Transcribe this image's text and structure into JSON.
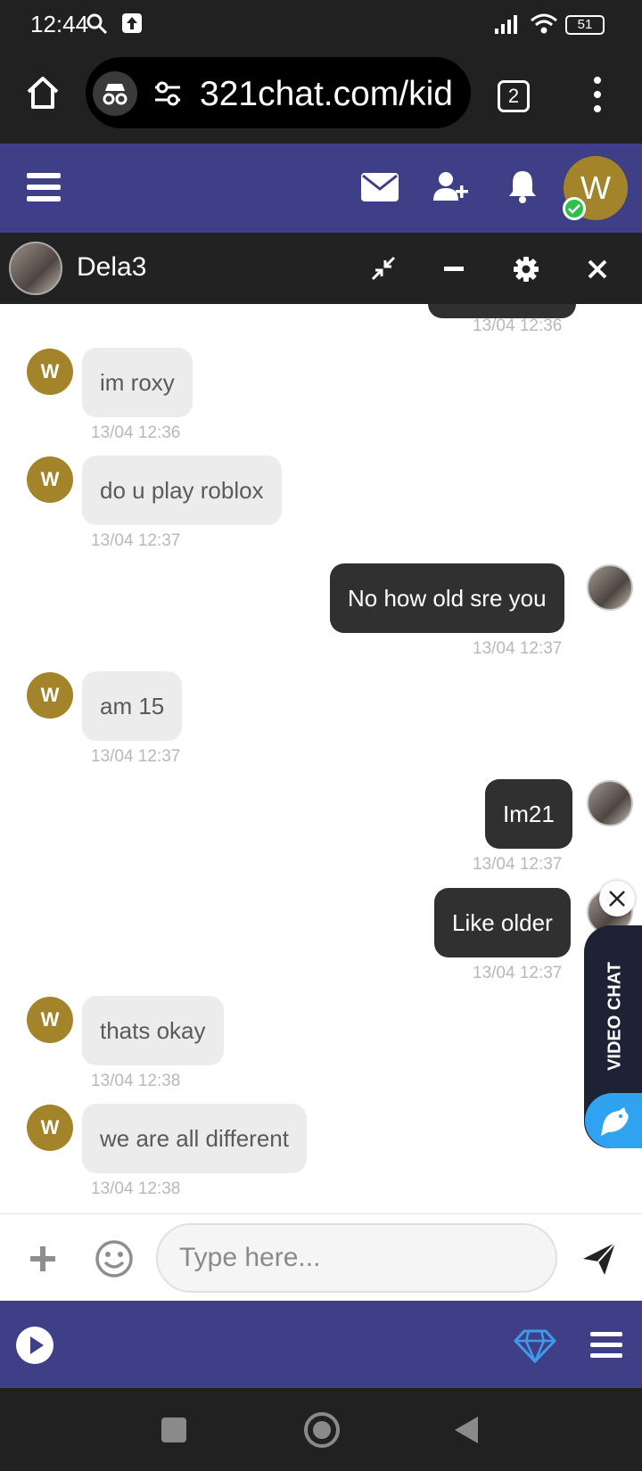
{
  "status_bar": {
    "time": "12:44",
    "battery": "51"
  },
  "browser": {
    "url": "321chat.com/kid",
    "tab_count": "2"
  },
  "chat": {
    "contact_name": "Dela3"
  },
  "avatars": {
    "main_initial": "W",
    "contact_initial": "W"
  },
  "messages": [
    {
      "direction": "in",
      "text": "im roxy",
      "time": "13/04 12:36"
    },
    {
      "direction": "in",
      "text": "do u play roblox",
      "time": "13/04 12:37"
    },
    {
      "direction": "out",
      "text": "No how old sre you",
      "time": "13/04 12:37"
    },
    {
      "direction": "in",
      "text": "am 15",
      "time": "13/04 12:37"
    },
    {
      "direction": "out",
      "text": "Im21",
      "time": "13/04 12:37"
    },
    {
      "direction": "out",
      "text": "Like older",
      "time": "13/04 12:37"
    },
    {
      "direction": "in",
      "text": "thats okay",
      "time": "13/04 12:38"
    },
    {
      "direction": "in",
      "text": "we are all different",
      "time": "13/04 12:38"
    }
  ],
  "top_partial_timestamp": "13/04 12:36",
  "video_widget": {
    "label": "VIDEO CHAT"
  },
  "input": {
    "placeholder": "Type here..."
  },
  "colors": {
    "header_bg": "#3e3f86",
    "avatar_bg": "#a3842a",
    "online": "#2ec04a",
    "diamond": "#3f9bea",
    "video_bird": "#2fa3ef"
  }
}
